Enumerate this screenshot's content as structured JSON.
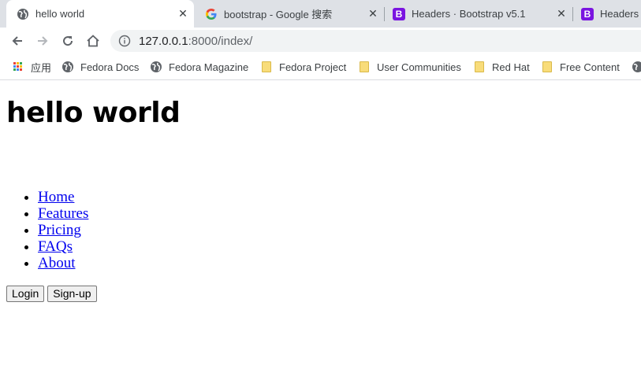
{
  "browser": {
    "tabs": [
      {
        "title": "hello world",
        "favicon": "globe-icon",
        "active": true
      },
      {
        "title": "bootstrap - Google 搜索",
        "favicon": "google-icon",
        "active": false
      },
      {
        "title": "Headers · Bootstrap v5.1",
        "favicon": "bootstrap-icon",
        "active": false,
        "badge": "B"
      },
      {
        "title": "Headers",
        "favicon": "bootstrap-icon",
        "active": false,
        "badge": "B"
      }
    ],
    "address": {
      "host": "127.0.0.1",
      "path": ":8000/index/"
    },
    "bookmarks": [
      {
        "label": "应用",
        "icon": "apps-grid-icon"
      },
      {
        "label": "Fedora Docs",
        "icon": "globe-icon"
      },
      {
        "label": "Fedora Magazine",
        "icon": "globe-icon"
      },
      {
        "label": "Fedora Project",
        "icon": "folder-icon"
      },
      {
        "label": "User Communities",
        "icon": "folder-icon"
      },
      {
        "label": "Red Hat",
        "icon": "folder-icon"
      },
      {
        "label": "Free Content",
        "icon": "folder-icon"
      }
    ]
  },
  "page": {
    "heading": "hello world",
    "nav": [
      "Home",
      "Features",
      "Pricing",
      "FAQs",
      "About"
    ],
    "buttons": {
      "login": "Login",
      "signup": "Sign-up"
    }
  },
  "colors": {
    "link": "#0000ee",
    "bootstrap_purple": "#7a14e0",
    "tabstrip": "#dee1e6"
  }
}
